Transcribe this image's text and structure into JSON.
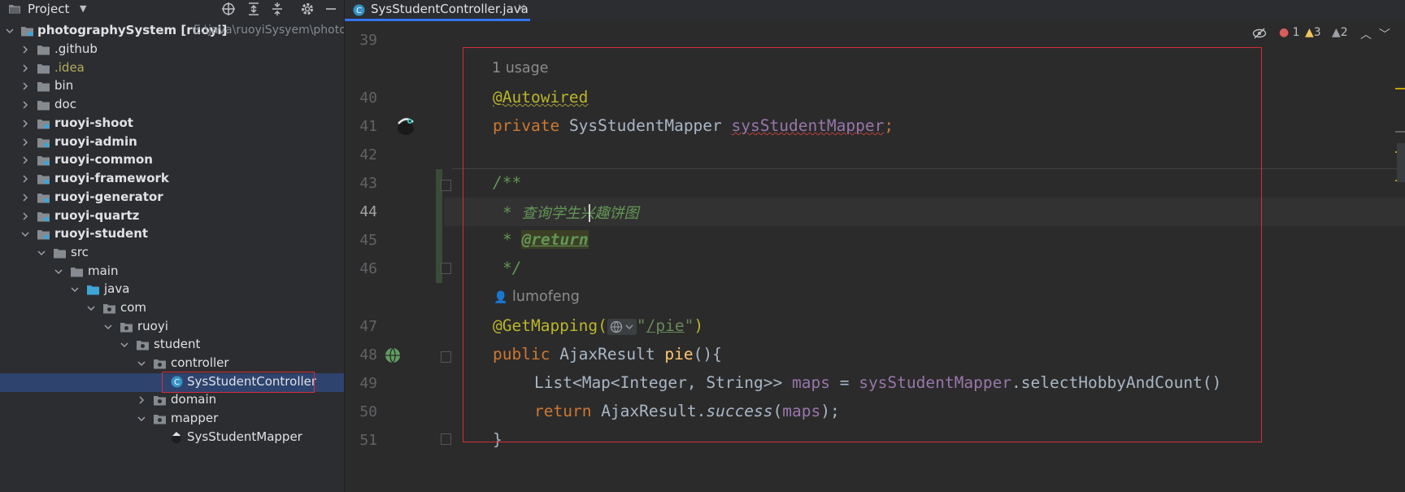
{
  "project_panel": {
    "title": "Project",
    "dropdown_icon": "chevron-down-icon",
    "toolbar_icons": [
      "crosshair-icon",
      "expand-all-icon",
      "collapse-all-icon",
      "gear-icon",
      "minimize-icon"
    ],
    "root": {
      "name": "photographySystem [ruoyi]",
      "path": "E:\\java\\ruoyiSysyem\\photog"
    },
    "items": [
      {
        "label": ".github"
      },
      {
        "label": ".idea"
      },
      {
        "label": "bin"
      },
      {
        "label": "doc"
      },
      {
        "label": "ruoyi-shoot"
      },
      {
        "label": "ruoyi-admin"
      },
      {
        "label": "ruoyi-common"
      },
      {
        "label": "ruoyi-framework"
      },
      {
        "label": "ruoyi-generator"
      },
      {
        "label": "ruoyi-quartz"
      },
      {
        "label": "ruoyi-student"
      },
      {
        "label": "src"
      },
      {
        "label": "main"
      },
      {
        "label": "java"
      },
      {
        "label": "com"
      },
      {
        "label": "ruoyi"
      },
      {
        "label": "student"
      },
      {
        "label": "controller"
      },
      {
        "label": "SysStudentController"
      },
      {
        "label": "domain"
      },
      {
        "label": "mapper"
      },
      {
        "label": "SysStudentMapper"
      }
    ]
  },
  "tab": {
    "label": "SysStudentController.java",
    "icon": "class-icon"
  },
  "inspections": {
    "errors": "1",
    "warnings": "3",
    "weak_warnings": "2"
  },
  "editor": {
    "line_numbers": [
      "39",
      "40",
      "41",
      "42",
      "43",
      "44",
      "45",
      "46",
      "47",
      "48",
      "49",
      "50",
      "51"
    ],
    "usage_hint": "1 usage",
    "author_hint": "lumofeng",
    "code": {
      "autowired": "@Autowired",
      "private_kw": "private",
      "mapper_type": "SysStudentMapper",
      "mapper_field": "sysStudentMapper",
      "semicolon": ";",
      "doc_open": "/**",
      "doc_star1": "* ",
      "doc_text": "查询学生兴趣饼图",
      "doc_star2": "* ",
      "doc_return": "@return",
      "doc_close": "*/",
      "getmapping": "@GetMapping(",
      "mapping_path": "/pie",
      "mapping_close": ")",
      "public_kw": "public",
      "ajax_type": "AjaxResult",
      "method_name": "pie",
      "method_rest": "(){",
      "list_type": "List<Map<Integer, String>>",
      "maps_var": "maps",
      "assign": " = ",
      "mapper_call_obj": "sysStudentMapper",
      "mapper_call_rest": ".selectHobbyAndCount()",
      "return_kw": "return",
      "ajax_class": "AjaxResult.",
      "success_fn": "success",
      "success_args_open": "(",
      "success_args_close": ");",
      "closing_brace": "}"
    }
  },
  "colors": {
    "accent": "#3574f0",
    "highlight_box": "#d32f38",
    "keyword": "#cc7832",
    "annotation": "#bbb529",
    "field": "#9876aa",
    "doc_comment": "#629755"
  }
}
